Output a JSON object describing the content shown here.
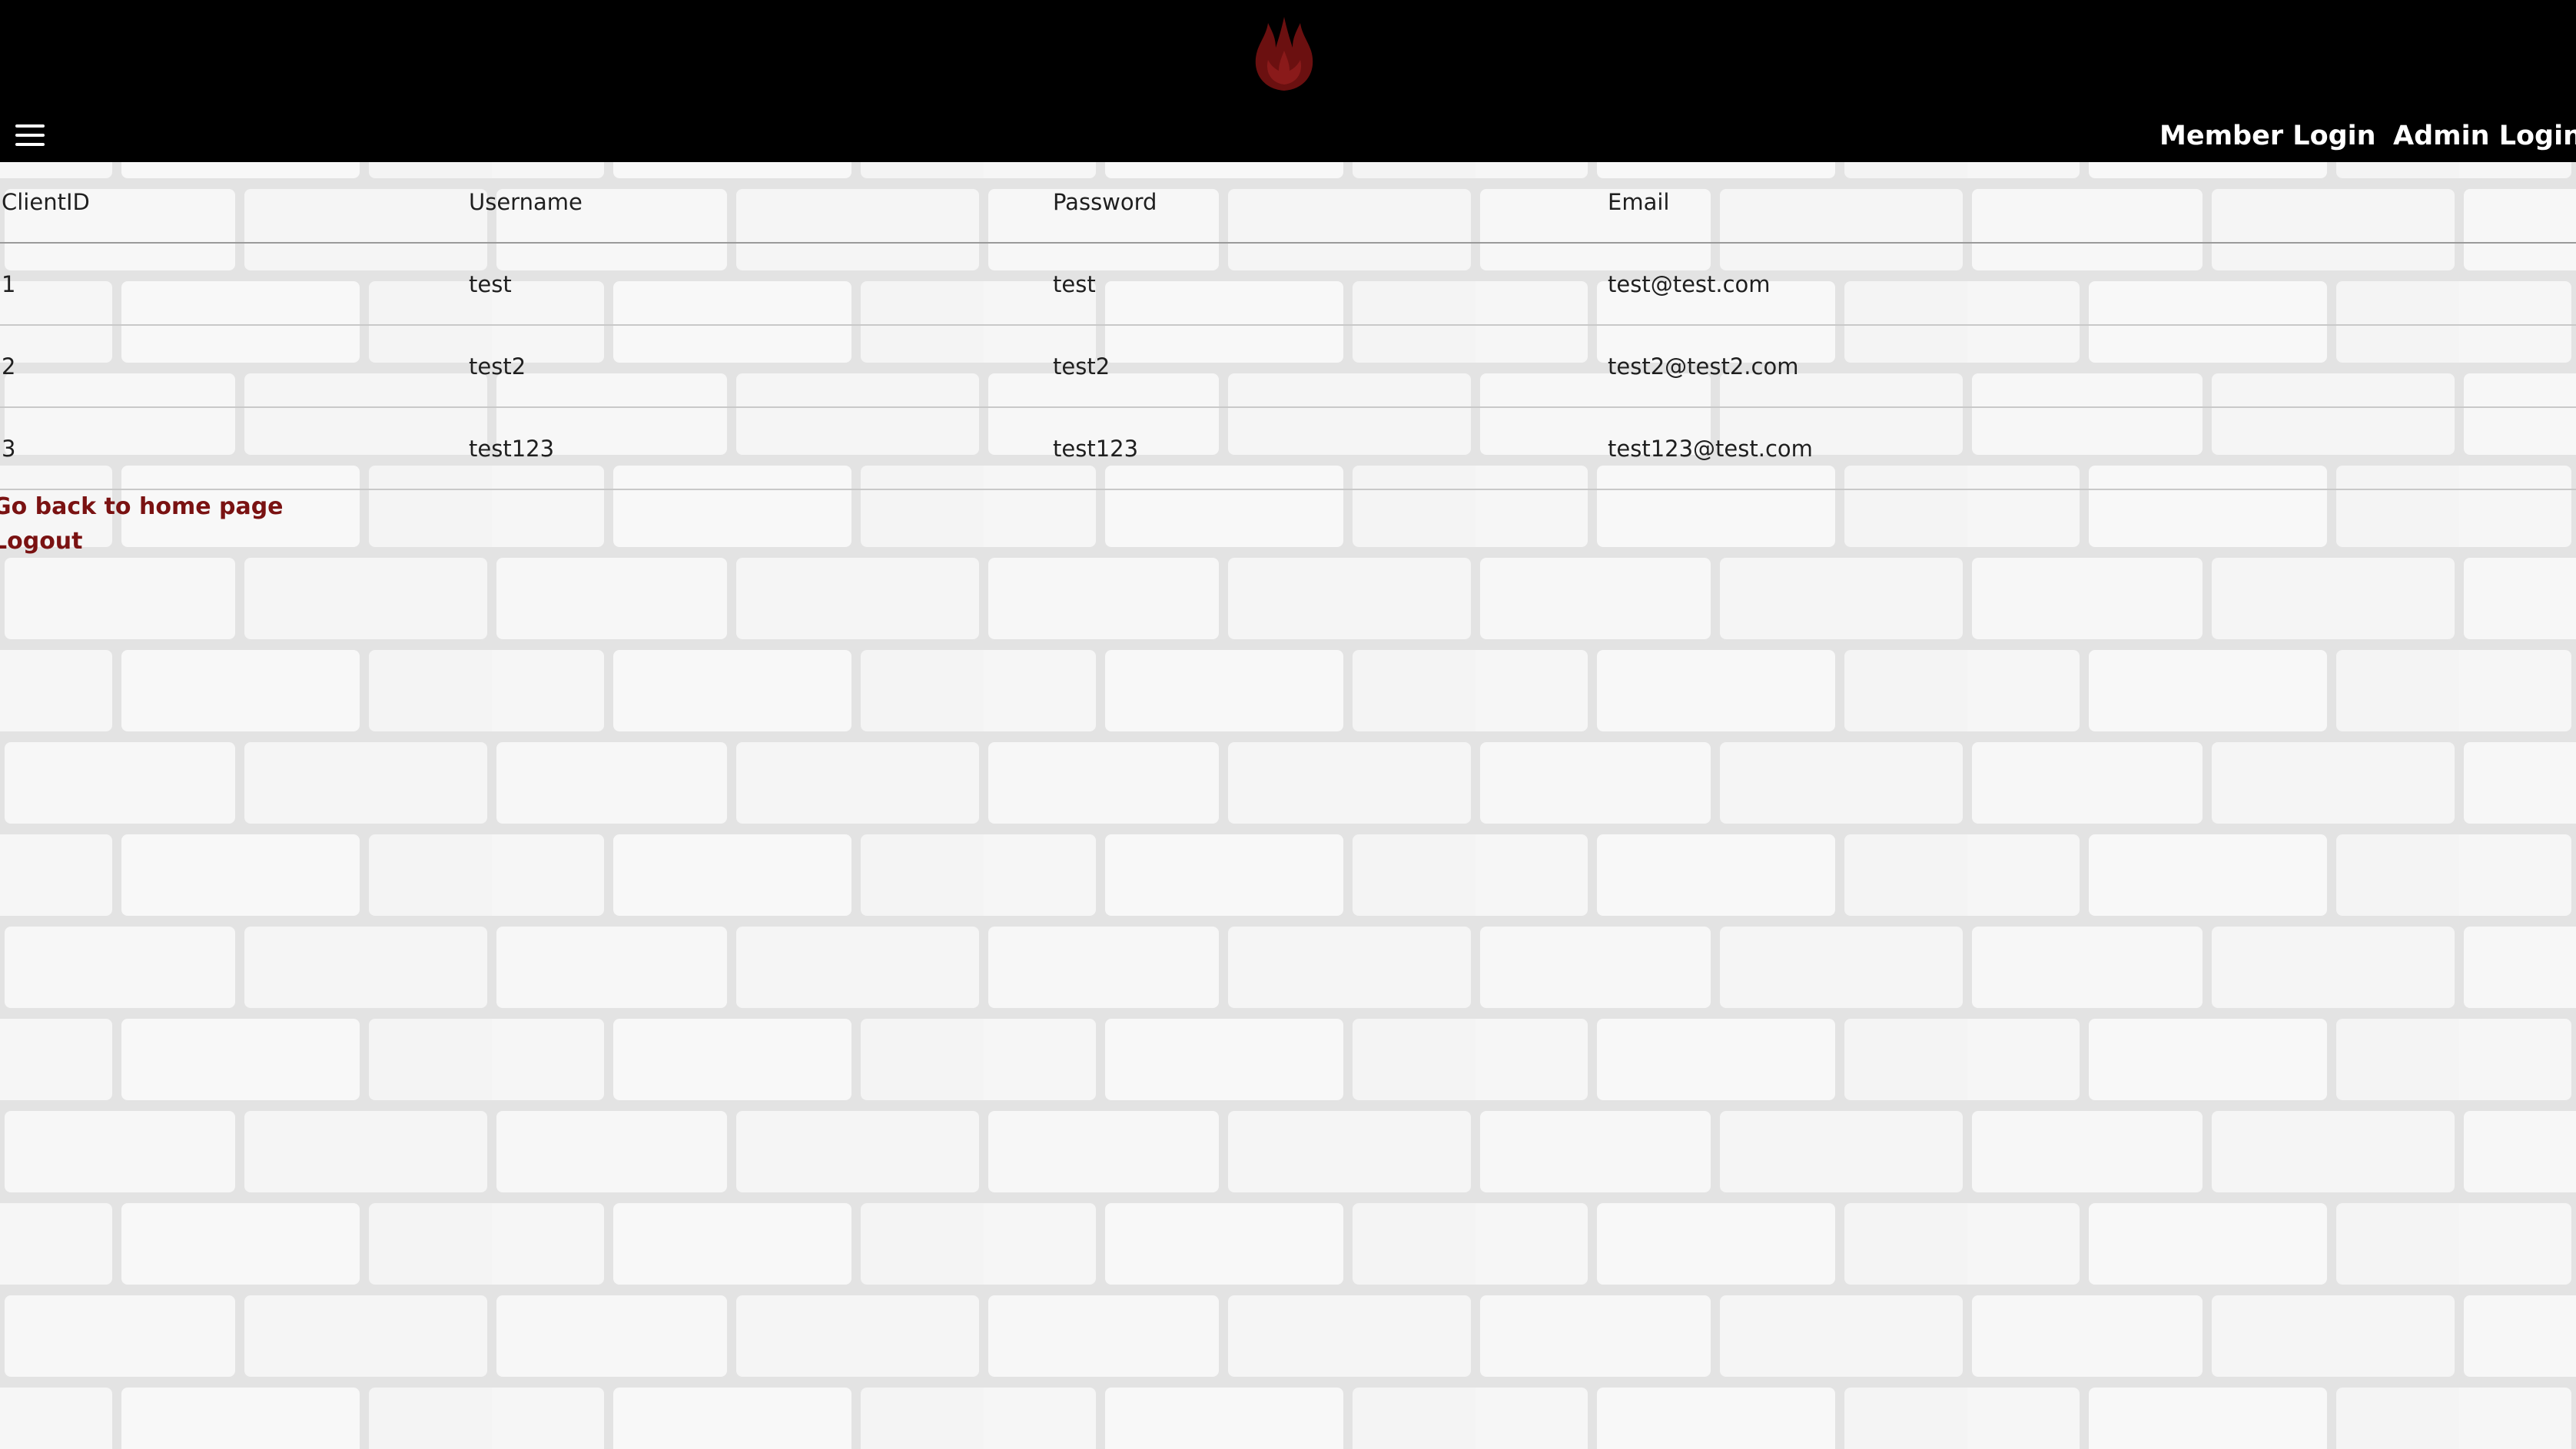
{
  "header": {
    "logo_icon": "flame-icon",
    "menu_icon": "hamburger-menu-icon",
    "nav": [
      {
        "label": "Member Login"
      },
      {
        "label": "Admin Login"
      }
    ]
  },
  "table": {
    "columns": [
      "ClientID",
      "Username",
      "Password",
      "Email"
    ],
    "rows": [
      [
        "1",
        "test",
        "test",
        "test@test.com"
      ],
      [
        "2",
        "test2",
        "test2",
        "test2@test2.com"
      ],
      [
        "3",
        "test123",
        "test123",
        "test123@test.com"
      ]
    ]
  },
  "links": {
    "home": "Go back to home page",
    "logout": "Logout"
  },
  "colors": {
    "header_bg": "#000000",
    "link": "#7a1212",
    "logo": "#6b1010"
  }
}
